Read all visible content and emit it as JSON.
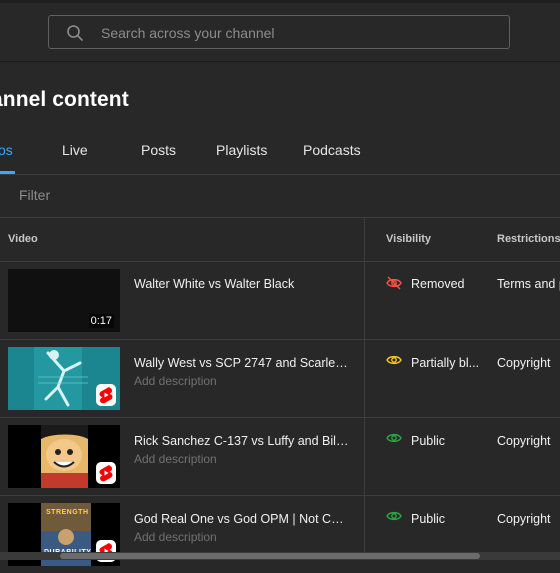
{
  "search": {
    "placeholder": "Search across your channel"
  },
  "page": {
    "title": "annel content"
  },
  "tabs": [
    {
      "label": "os",
      "active": true
    },
    {
      "label": "Live"
    },
    {
      "label": "Posts"
    },
    {
      "label": "Playlists"
    },
    {
      "label": "Podcasts"
    }
  ],
  "filter": {
    "label": "Filter"
  },
  "table": {
    "headers": {
      "video": "Video",
      "visibility": "Visibility",
      "restrictions": "Restrictions"
    },
    "rows": [
      {
        "title": "Walter White vs Walter Black",
        "description": "",
        "duration": "0:17",
        "thumbnail": "dark-frame",
        "shorts_badge": false,
        "visibility": "Removed",
        "visibility_icon": "eye-off-icon",
        "visibility_color": "#ff4e45",
        "restrictions": "Terms and p"
      },
      {
        "title": "Wally West vs SCP 2747 and Scarlet ...",
        "description": "Add description",
        "duration": "",
        "thumbnail": "teal-figure",
        "shorts_badge": true,
        "visibility": "Partially bl...",
        "visibility_icon": "eye-icon",
        "visibility_color": "#f9c51c",
        "restrictions": "Copyright"
      },
      {
        "title": "Rick Sanchez C-137 vs Luffy and Bill ...",
        "description": "Add description",
        "duration": "",
        "thumbnail": "anime-face",
        "shorts_badge": true,
        "visibility": "Public",
        "visibility_icon": "eye-icon",
        "visibility_color": "#2ba640",
        "restrictions": "Copyright"
      },
      {
        "title": "God Real One vs God OPM | Not Capi...",
        "description": "Add description",
        "duration": "",
        "thumbnail": "strength-durability",
        "thumbnail_text_top": "STRENGTH",
        "thumbnail_text_bottom": "DURABILITY",
        "shorts_badge": true,
        "visibility": "Public",
        "visibility_icon": "eye-icon",
        "visibility_color": "#2ba640",
        "restrictions": "Copyright"
      }
    ]
  },
  "colors": {
    "background": "#282828",
    "accent": "#3ea6ff",
    "shorts_red": "#ff0000"
  }
}
